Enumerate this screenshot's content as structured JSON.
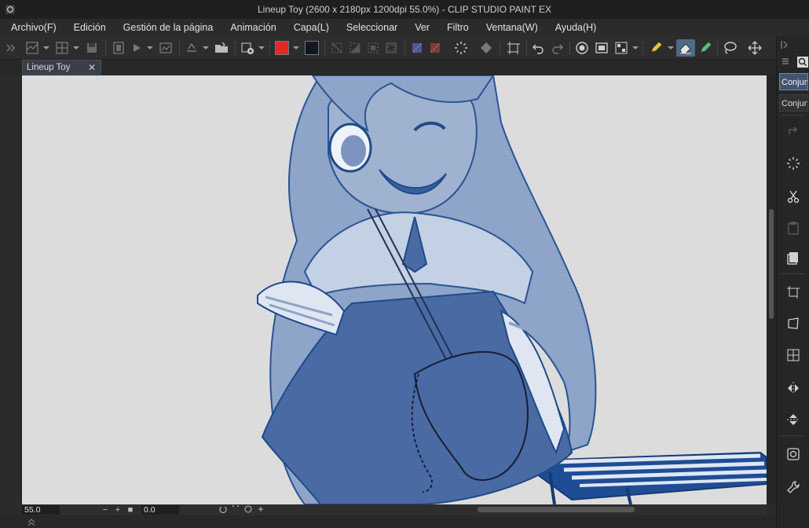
{
  "window": {
    "title": "Lineup Toy (2600 x 2180px 1200dpi 55.0%)  - CLIP STUDIO PAINT EX"
  },
  "menu": {
    "items": [
      {
        "label": "Archivo(F)"
      },
      {
        "label": "Edición"
      },
      {
        "label": "Gestión de la página"
      },
      {
        "label": "Animación"
      },
      {
        "label": "Capa(L)"
      },
      {
        "label": "Seleccionar"
      },
      {
        "label": "Ver"
      },
      {
        "label": "Filtro"
      },
      {
        "label": "Ventana(W)"
      },
      {
        "label": "Ayuda(H)"
      }
    ]
  },
  "toolbar": {
    "main_color": "#e02a2a",
    "sub_color": "#121620"
  },
  "document": {
    "tab_label": "Lineup Toy",
    "close_glyph": "✕"
  },
  "status": {
    "zoom": "55.0",
    "rotation": "0.0",
    "zoom_out_glyph": "−",
    "zoom_in_glyph": "+",
    "fit_glyph": "■"
  },
  "right_panel": {
    "tabs": [
      {
        "label": "Conjunto"
      },
      {
        "label": "Conjunto"
      }
    ]
  },
  "colors": {
    "canvas_bg": "#dcdcdc",
    "line_blue": "#1e4a8a",
    "skin_blue": "#9fb2d0",
    "shirt_blue": "#c4d0e4",
    "skirt_blue": "#4a6aa4",
    "hair_blue": "#8ea4c8",
    "keyboard_blue": "#1f4d95"
  }
}
